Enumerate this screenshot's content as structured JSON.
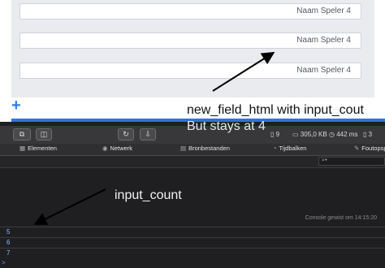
{
  "page": {
    "fields": [
      {
        "value": "Naam Speler 4"
      },
      {
        "value": "Naam Speler 4"
      },
      {
        "value": "Naam Speler 4"
      }
    ],
    "add_symbol": "+"
  },
  "annotations": {
    "top_line1": "new_field_html with input_cout",
    "top_line2": "But stays at 4",
    "bottom": "input_count"
  },
  "devtools": {
    "stats": {
      "resources": "9",
      "size": "305,0 KB",
      "time": "442 ms",
      "errors": "3"
    },
    "tabs": [
      {
        "icon": "elements-icon",
        "label": "Elementen"
      },
      {
        "icon": "network-icon",
        "label": "Netwerk"
      },
      {
        "icon": "sources-icon",
        "label": "Bronbestanden"
      },
      {
        "icon": "timelines-icon",
        "label": "Tijdbalken"
      },
      {
        "icon": "debugger-icon",
        "label": "Foutopsporing"
      }
    ],
    "filter_icon": "search-icon",
    "console_status": "Console gewist om 14:15:20",
    "log": [
      "5",
      "6",
      "7"
    ],
    "prompt_symbol": ">"
  },
  "colors": {
    "accent": "#2b74db",
    "log_text": "#8fb8ff",
    "annotation_arrow": "#000000"
  }
}
